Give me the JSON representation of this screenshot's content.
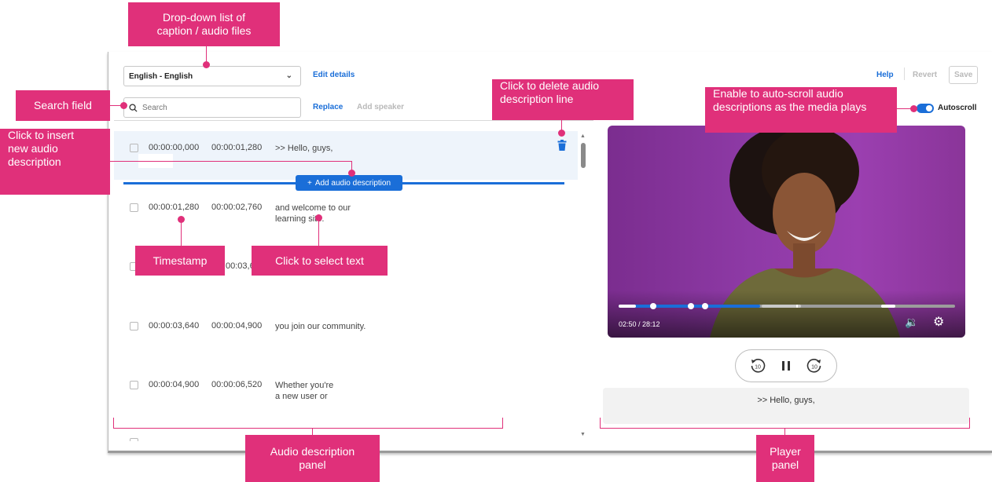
{
  "toolbar": {
    "language_select": "English - English",
    "edit_details": "Edit details",
    "help": "Help",
    "revert": "Revert",
    "save": "Save"
  },
  "search": {
    "placeholder": "Search",
    "replace": "Replace",
    "add_speaker": "Add speaker"
  },
  "autoscroll": {
    "label": "Autoscroll",
    "enabled": true
  },
  "rows": [
    {
      "start": "00:00:00,000",
      "end": "00:00:01,280",
      "text": ">> Hello, guys,"
    },
    {
      "start": "00:00:01,280",
      "end": "00:00:02,760",
      "text": "and welcome to our",
      "text2": "learning site."
    },
    {
      "start": "",
      "end": "00:03,6",
      "text": ""
    },
    {
      "start": "00:00:03,640",
      "end": "00:00:04,900",
      "text": "you join our community."
    },
    {
      "start": "00:00:04,900",
      "end": "00:00:06,520",
      "text": "Whether you're",
      "text2": "a new user or"
    }
  ],
  "add_audio_description": "Add audio description",
  "player": {
    "time": "02:50 / 28:12",
    "progress_fraction": 0.42,
    "caption_text": ">> Hello, guys,"
  },
  "callouts": {
    "dropdown_line1": "Drop-down list of",
    "dropdown_line2": "caption / audio files",
    "search_field": "Search field",
    "insert_line1": "Click to insert",
    "insert_line2": "new audio",
    "insert_line3": "description",
    "delete_line1": "Click to delete audio",
    "delete_line2": "description line",
    "autoscroll_line1": "Enable to auto-scroll audio",
    "autoscroll_line2": "descriptions as the media plays",
    "timestamp": "Timestamp",
    "select_text": "Click to select text",
    "ad_panel_line1": "Audio description",
    "ad_panel_line2": "panel",
    "player_panel_line1": "Player",
    "player_panel_line2": "panel"
  },
  "colors": {
    "accent": "#1a6ed8",
    "callout": "#e0307a"
  }
}
